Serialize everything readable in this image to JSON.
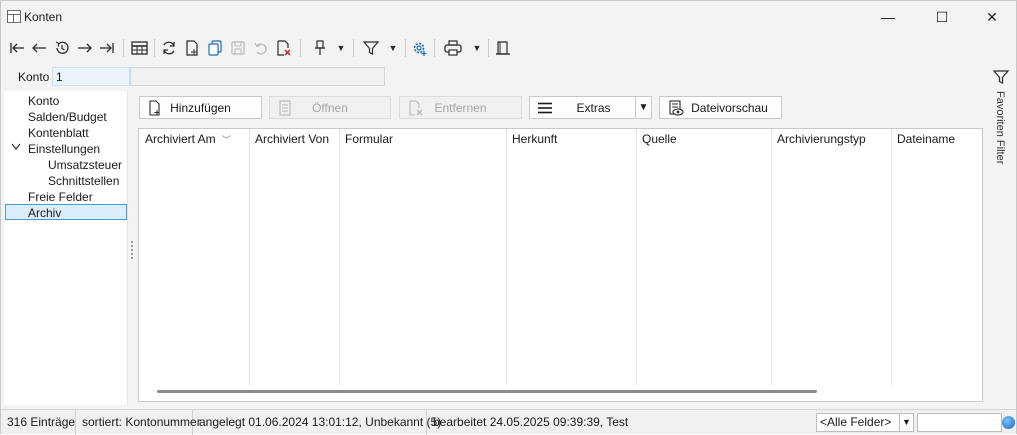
{
  "window": {
    "title": "Konten",
    "minimize": "—",
    "maximize": "☐",
    "close": "✕"
  },
  "toolbar": {
    "icons": [
      "first-record-icon",
      "prev-record-icon",
      "history-icon",
      "next-record-icon",
      "last-record-icon",
      "table-view-icon",
      "refresh-icon",
      "new-document-icon",
      "copy-icon",
      "save-icon",
      "undo-icon",
      "delete-icon",
      "pin-icon",
      "filter-icon",
      "settings-icon",
      "print-icon",
      "bookmark-icon"
    ]
  },
  "konto": {
    "label": "Konto",
    "value": "1"
  },
  "tree": {
    "items": [
      {
        "label": "Konto",
        "level": 0
      },
      {
        "label": "Salden/Budget",
        "level": 0
      },
      {
        "label": "Kontenblatt",
        "level": 0
      },
      {
        "label": "Einstellungen",
        "level": 0,
        "expanded": true
      },
      {
        "label": "Umsatzsteuer",
        "level": 1
      },
      {
        "label": "Schnittstellen",
        "level": 1
      },
      {
        "label": "Freie Felder",
        "level": 0
      },
      {
        "label": "Archiv",
        "level": 0,
        "selected": true
      }
    ],
    "chevron": "✓"
  },
  "buttons": {
    "add": "Hinzufügen",
    "open": "Öffnen",
    "remove": "Entfernen",
    "extras": "Extras",
    "preview": "Dateivorschau"
  },
  "grid": {
    "columns": [
      "Archiviert Am",
      "Archiviert Von",
      "Formular",
      "Herkunft",
      "Quelle",
      "Archivierungstyp",
      "Dateiname"
    ],
    "sort_indicator": "﹀",
    "rows": []
  },
  "side_filter": {
    "label": "Favoriten Filter"
  },
  "status": {
    "count": "316 Einträge",
    "sort": "sortiert: Kontonummer",
    "created": "angelegt 01.06.2024 13:01:12, Unbekannt (5)",
    "edited": "bearbeitet 24.05.2025 09:39:39, Test",
    "fields": "<Alle Felder>"
  },
  "colors": {
    "accent": "#4a9ad8",
    "selection": "#dceefc",
    "input_bg": "#eaf3fc"
  }
}
